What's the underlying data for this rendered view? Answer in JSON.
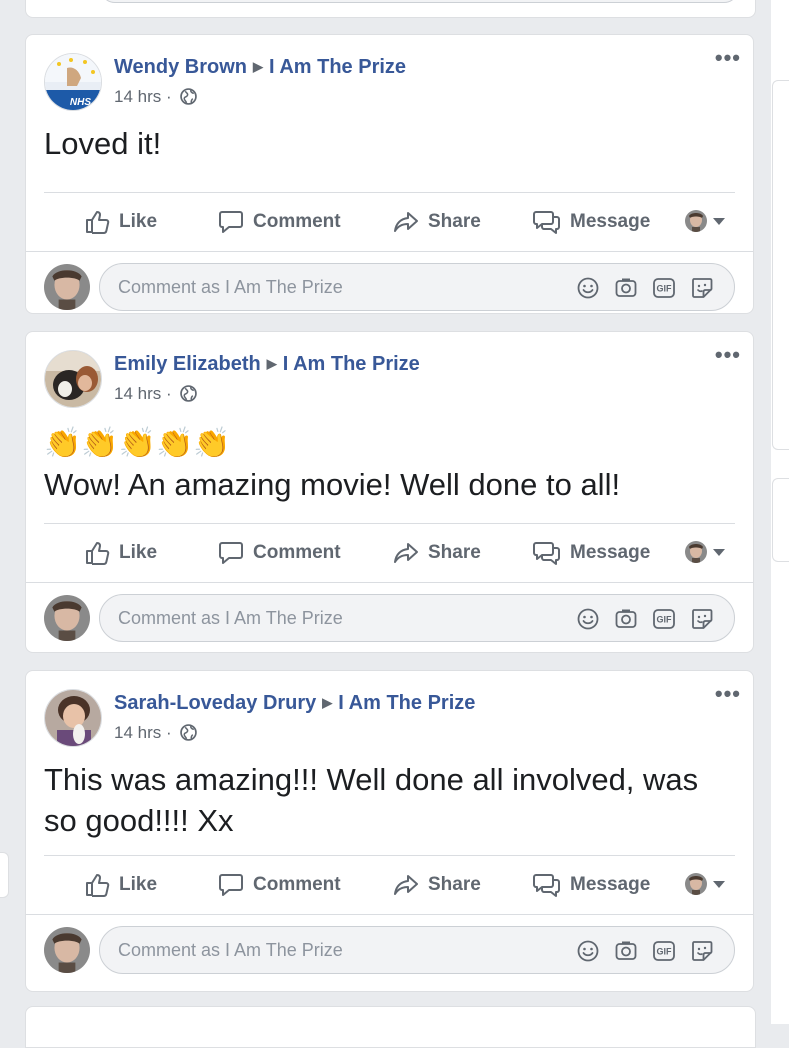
{
  "feed": {
    "action_labels": {
      "like": "Like",
      "comment": "Comment",
      "share": "Share",
      "message": "Message"
    },
    "comment_placeholder": "Comment as I Am The Prize",
    "page_name": "I Am The Prize",
    "posts": [
      {
        "author": "Wendy Brown",
        "target": "I Am The Prize",
        "time": "14 hrs ·",
        "text": "Loved it!",
        "avatar_badge": "NHS"
      },
      {
        "author": "Emily Elizabeth",
        "target": "I Am The Prize",
        "time": "14 hrs ·",
        "emoji": "👏👏👏👏👏",
        "text": "Wow! An amazing movie! Well done to all!"
      },
      {
        "author": "Sarah-Loveday Drury",
        "target": "I Am The Prize",
        "time": "14 hrs ·",
        "text": "This was amazing!!! Well done all involved, was so good!!!! Xx"
      }
    ]
  },
  "icons": [
    "like-icon",
    "comment-icon",
    "share-icon",
    "message-icon",
    "globe-icon",
    "more-icon",
    "emoji-icon",
    "camera-icon",
    "gif-icon",
    "sticker-icon"
  ],
  "colors": {
    "author_link": "#385898",
    "meta": "#606770",
    "background": "#e9ebee"
  }
}
